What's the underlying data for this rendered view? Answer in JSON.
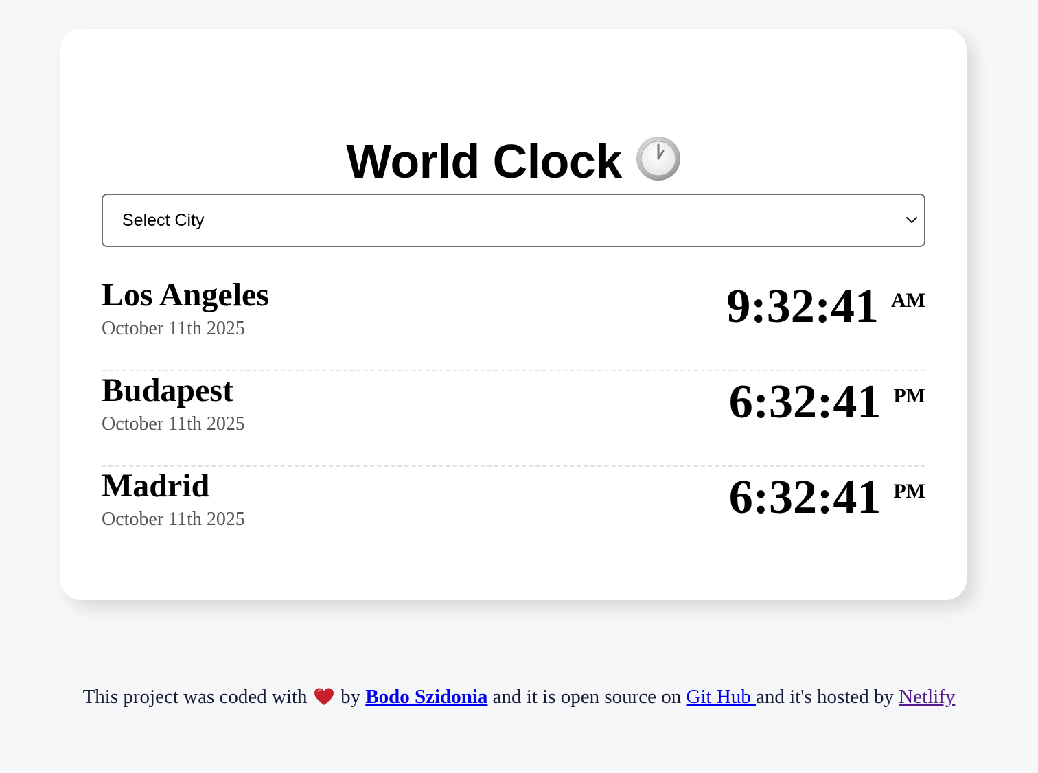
{
  "header": {
    "title": "World Clock",
    "icon": "clock-icon"
  },
  "city_select": {
    "selected_label": "Select City",
    "icon": "chevron-down-icon"
  },
  "cities": [
    {
      "name": "Los Angeles",
      "date": "October 11th 2025",
      "time": "9:32:41",
      "ampm": "AM"
    },
    {
      "name": "Budapest",
      "date": "October 11th 2025",
      "time": "6:32:41",
      "ampm": "PM"
    },
    {
      "name": "Madrid",
      "date": "October 11th 2025",
      "time": "6:32:41",
      "ampm": "PM"
    }
  ],
  "footer": {
    "text_1": "This project was coded with",
    "heart_icon": "heart-icon",
    "text_2": "by",
    "author_link": "Bodo Szidonia",
    "text_3": "and it is open source on",
    "github_link": "Git Hub ",
    "text_4": "and it's hosted by",
    "netlify_link": "Netlify"
  },
  "colors": {
    "background": "#f6f7f9",
    "card": "#ffffff",
    "link": "#0000ee",
    "visited_link": "#551a8b",
    "heart": "#c8202a"
  }
}
